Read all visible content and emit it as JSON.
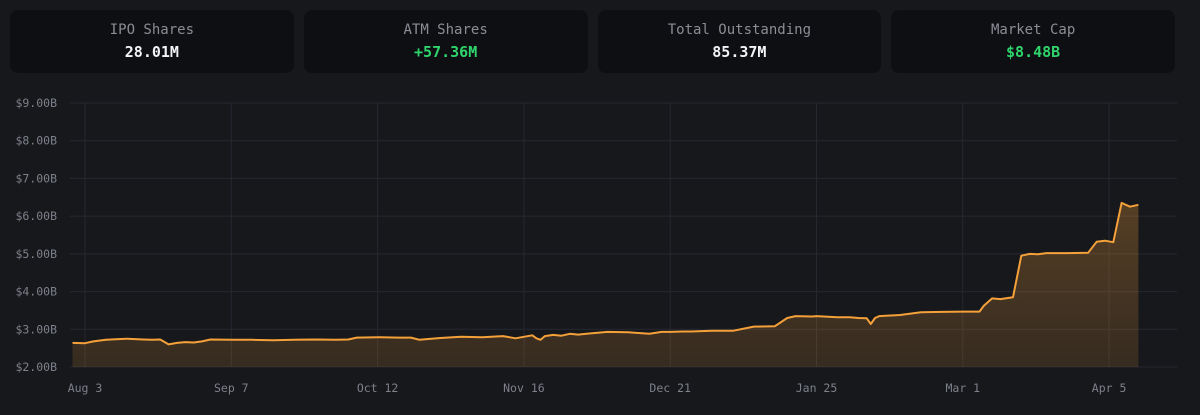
{
  "stats": [
    {
      "label": "IPO Shares",
      "value": "28.01M",
      "color": "#f2f3f5"
    },
    {
      "label": "ATM Shares",
      "value": "+57.36M",
      "color": "#2fd56c"
    },
    {
      "label": "Total Outstanding",
      "value": "85.37M",
      "color": "#f2f3f5"
    },
    {
      "label": "Market Cap",
      "value": "$8.48B",
      "color": "#2fd56c"
    }
  ],
  "chart_data": {
    "type": "area",
    "title": "",
    "xlabel": "",
    "ylabel": "",
    "ylim": [
      2.0,
      9.0
    ],
    "xlim": [
      0,
      252
    ],
    "y_ticks": [
      2,
      3,
      4,
      5,
      6,
      7,
      8,
      9
    ],
    "y_tick_labels": [
      "$2.00B",
      "$3.00B",
      "$4.00B",
      "$5.00B",
      "$6.00B",
      "$7.00B",
      "$8.00B",
      "$9.00B"
    ],
    "x_ticks": [
      0,
      35,
      70,
      105,
      140,
      175,
      210,
      245
    ],
    "x_tick_labels": [
      "Aug 3",
      "Sep 7",
      "Oct 12",
      "Nov 16",
      "Dec 21",
      "Jan 25",
      "Mar 1",
      "Apr 5"
    ],
    "grid": true,
    "line_color": "#f5a13a",
    "series": [
      {
        "x": [
          -3,
          0,
          2,
          5,
          8,
          10,
          12,
          14,
          16,
          18,
          20,
          22,
          24,
          26,
          28,
          30,
          35,
          40,
          45,
          50,
          55,
          60,
          63,
          65,
          70,
          75,
          78,
          80,
          85,
          90,
          95,
          100,
          103,
          105,
          107,
          108,
          109,
          110,
          112,
          114,
          116,
          118,
          120,
          125,
          130,
          135,
          138,
          140,
          143,
          145,
          150,
          155,
          160,
          165,
          168,
          170,
          174,
          175,
          180,
          183,
          185,
          187,
          188,
          189,
          190,
          195,
          200,
          205,
          210,
          214,
          215,
          217,
          219,
          222,
          224,
          226,
          228,
          230,
          235,
          240,
          242,
          244,
          246,
          248,
          250,
          252
        ],
        "values": [
          2.64,
          2.63,
          2.68,
          2.72,
          2.74,
          2.75,
          2.74,
          2.73,
          2.72,
          2.73,
          2.6,
          2.64,
          2.66,
          2.65,
          2.68,
          2.73,
          2.72,
          2.72,
          2.71,
          2.72,
          2.73,
          2.72,
          2.73,
          2.78,
          2.79,
          2.78,
          2.78,
          2.72,
          2.77,
          2.8,
          2.79,
          2.82,
          2.76,
          2.8,
          2.84,
          2.76,
          2.72,
          2.82,
          2.85,
          2.83,
          2.88,
          2.86,
          2.88,
          2.93,
          2.92,
          2.88,
          2.93,
          2.93,
          2.94,
          2.94,
          2.96,
          2.96,
          3.07,
          3.08,
          3.3,
          3.35,
          3.34,
          3.35,
          3.32,
          3.32,
          3.3,
          3.29,
          3.14,
          3.3,
          3.35,
          3.38,
          3.45,
          3.46,
          3.47,
          3.47,
          3.62,
          3.82,
          3.8,
          3.85,
          4.95,
          5.0,
          4.99,
          5.02,
          5.02,
          5.03,
          5.32,
          5.35,
          5.31,
          6.35,
          6.25,
          6.3
        ]
      }
    ]
  }
}
